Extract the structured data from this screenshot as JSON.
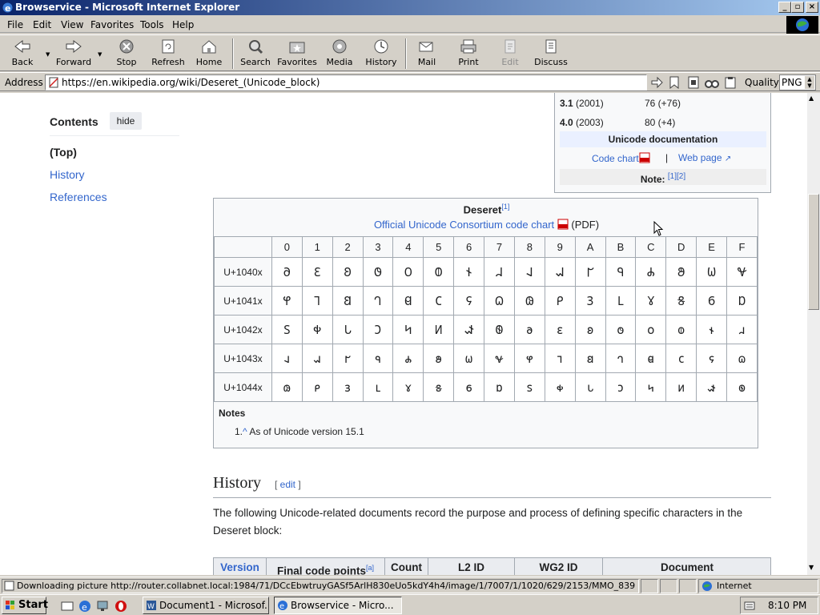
{
  "window": {
    "title": "Browservice - Microsoft Internet Explorer"
  },
  "menu": [
    "File",
    "Edit",
    "View",
    "Favorites",
    "Tools",
    "Help"
  ],
  "toolbar": {
    "back": "Back",
    "forward": "Forward",
    "stop": "Stop",
    "refresh": "Refresh",
    "home": "Home",
    "search": "Search",
    "favorites": "Favorites",
    "media": "Media",
    "history": "History",
    "mail": "Mail",
    "print": "Print",
    "edit": "Edit",
    "discuss": "Discuss"
  },
  "address": {
    "label": "Address",
    "url": "https://en.wikipedia.org/wiki/Deseret_(Unicode_block)",
    "quality_label": "Quality",
    "quality_value": "PNG"
  },
  "toc": {
    "title": "Contents",
    "hide": "hide",
    "items": [
      "(Top)",
      "History",
      "References"
    ]
  },
  "infobox": {
    "rows": [
      {
        "version": "3.1",
        "year": " (2001)",
        "count": "76 (+76)"
      },
      {
        "version": "4.0",
        "year": " (2003)",
        "count": "80 (+4)"
      }
    ],
    "doc_header": "Unicode documentation",
    "code_chart": "Code chart",
    "separator": "|",
    "web_page": "Web page",
    "note_label": "Note:",
    "note_refs": "[1][2]"
  },
  "chart_table": {
    "title": "Deseret",
    "title_ref": "[1]",
    "subtitle_link": "Official Unicode Consortium code chart",
    "subtitle_pdf": "(PDF)",
    "col_headers": [
      "0",
      "1",
      "2",
      "3",
      "4",
      "5",
      "6",
      "7",
      "8",
      "9",
      "A",
      "B",
      "C",
      "D",
      "E",
      "F"
    ],
    "rows": [
      {
        "label": "U+1040x",
        "cells": [
          "𐐀",
          "𐐁",
          "𐐂",
          "𐐃",
          "𐐄",
          "𐐅",
          "𐐆",
          "𐐇",
          "𐐈",
          "𐐉",
          "𐐊",
          "𐐋",
          "𐐌",
          "𐐍",
          "𐐎",
          "𐐏"
        ]
      },
      {
        "label": "U+1041x",
        "cells": [
          "𐐐",
          "𐐑",
          "𐐒",
          "𐐓",
          "𐐔",
          "𐐕",
          "𐐖",
          "𐐗",
          "𐐘",
          "𐐙",
          "𐐚",
          "𐐛",
          "𐐜",
          "𐐝",
          "𐐞",
          "𐐟"
        ]
      },
      {
        "label": "U+1042x",
        "cells": [
          "𐐠",
          "𐐡",
          "𐐢",
          "𐐣",
          "𐐤",
          "𐐥",
          "𐐦",
          "𐐧",
          "𐐨",
          "𐐩",
          "𐐪",
          "𐐫",
          "𐐬",
          "𐐭",
          "𐐮",
          "𐐯"
        ]
      },
      {
        "label": "U+1043x",
        "cells": [
          "𐐰",
          "𐐱",
          "𐐲",
          "𐐳",
          "𐐴",
          "𐐵",
          "𐐶",
          "𐐷",
          "𐐸",
          "𐐹",
          "𐐺",
          "𐐻",
          "𐐼",
          "𐐽",
          "𐐾",
          "𐐿"
        ]
      },
      {
        "label": "U+1044x",
        "cells": [
          "𐑀",
          "𐑁",
          "𐑂",
          "𐑃",
          "𐑄",
          "𐑅",
          "𐑆",
          "𐑇",
          "𐑈",
          "𐑉",
          "𐑊",
          "𐑋",
          "𐑌",
          "𐑍",
          "𐑎",
          "𐑏"
        ]
      }
    ],
    "notes_label": "Notes",
    "note_1_num": "1.",
    "note_1_caret": "^",
    "note_1_text": "As of Unicode version 15.1"
  },
  "history": {
    "heading": "History",
    "edit": "edit",
    "paragraph": "The following Unicode-related documents record the purpose and process of defining specific characters in the Deseret block:",
    "table_headers": [
      "Version",
      "Final code points",
      "Count",
      "L2 ID",
      "WG2 ID",
      "Document"
    ],
    "final_code_points_ref": "[a]"
  },
  "status": {
    "text": "Downloading picture http://router.collabnet.local:1984/71/DCcEbwtruyGASf5ArlH830eUo5kdY4h4/image/1/7007/1/1020/629/2153/MMO_839",
    "zone": "Internet"
  },
  "taskbar": {
    "start": "Start",
    "tasks": [
      "Document1 - Microsof...",
      "Browservice - Micro..."
    ],
    "clock": "8:10 PM"
  }
}
